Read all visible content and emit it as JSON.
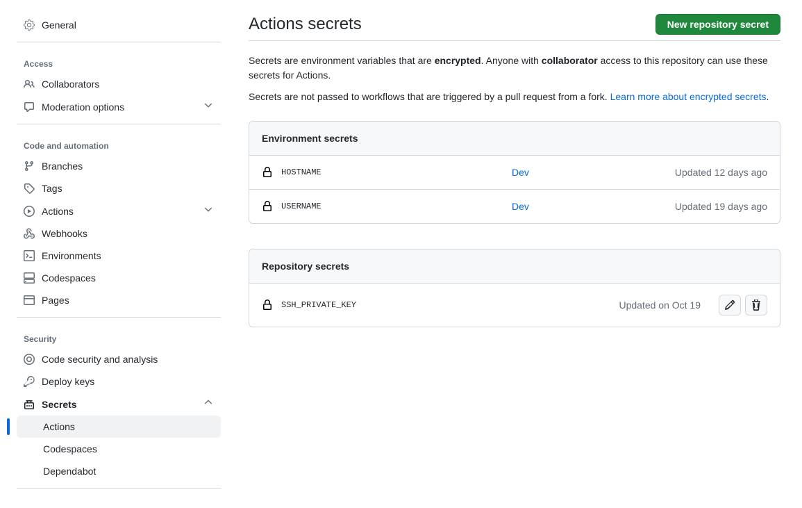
{
  "sidebar": {
    "general": "General",
    "access": {
      "heading": "Access",
      "collaborators": "Collaborators",
      "moderation": "Moderation options"
    },
    "code": {
      "heading": "Code and automation",
      "branches": "Branches",
      "tags": "Tags",
      "actions": "Actions",
      "webhooks": "Webhooks",
      "environments": "Environments",
      "codespaces": "Codespaces",
      "pages": "Pages"
    },
    "security": {
      "heading": "Security",
      "codesec": "Code security and analysis",
      "deploykeys": "Deploy keys",
      "secrets": "Secrets",
      "secrets_sub": {
        "actions": "Actions",
        "codespaces": "Codespaces",
        "dependabot": "Dependabot"
      }
    }
  },
  "main": {
    "title": "Actions secrets",
    "new_button": "New repository secret",
    "desc1_pre": "Secrets are environment variables that are ",
    "desc1_b1": "encrypted",
    "desc1_mid": ". Anyone with ",
    "desc1_b2": "collaborator",
    "desc1_post": " access to this repository can use these secrets for Actions.",
    "desc2_pre": "Secrets are not passed to workflows that are triggered by a pull request from a fork. ",
    "desc2_link": "Learn more about encrypted secrets",
    "desc2_post": ".",
    "env_header": "Environment secrets",
    "env_rows": [
      {
        "name": "HOSTNAME",
        "env": "Dev",
        "updated": "Updated 12 days ago"
      },
      {
        "name": "USERNAME",
        "env": "Dev",
        "updated": "Updated 19 days ago"
      }
    ],
    "repo_header": "Repository secrets",
    "repo_rows": [
      {
        "name": "SSH_PRIVATE_KEY",
        "updated": "Updated on Oct 19"
      }
    ]
  }
}
